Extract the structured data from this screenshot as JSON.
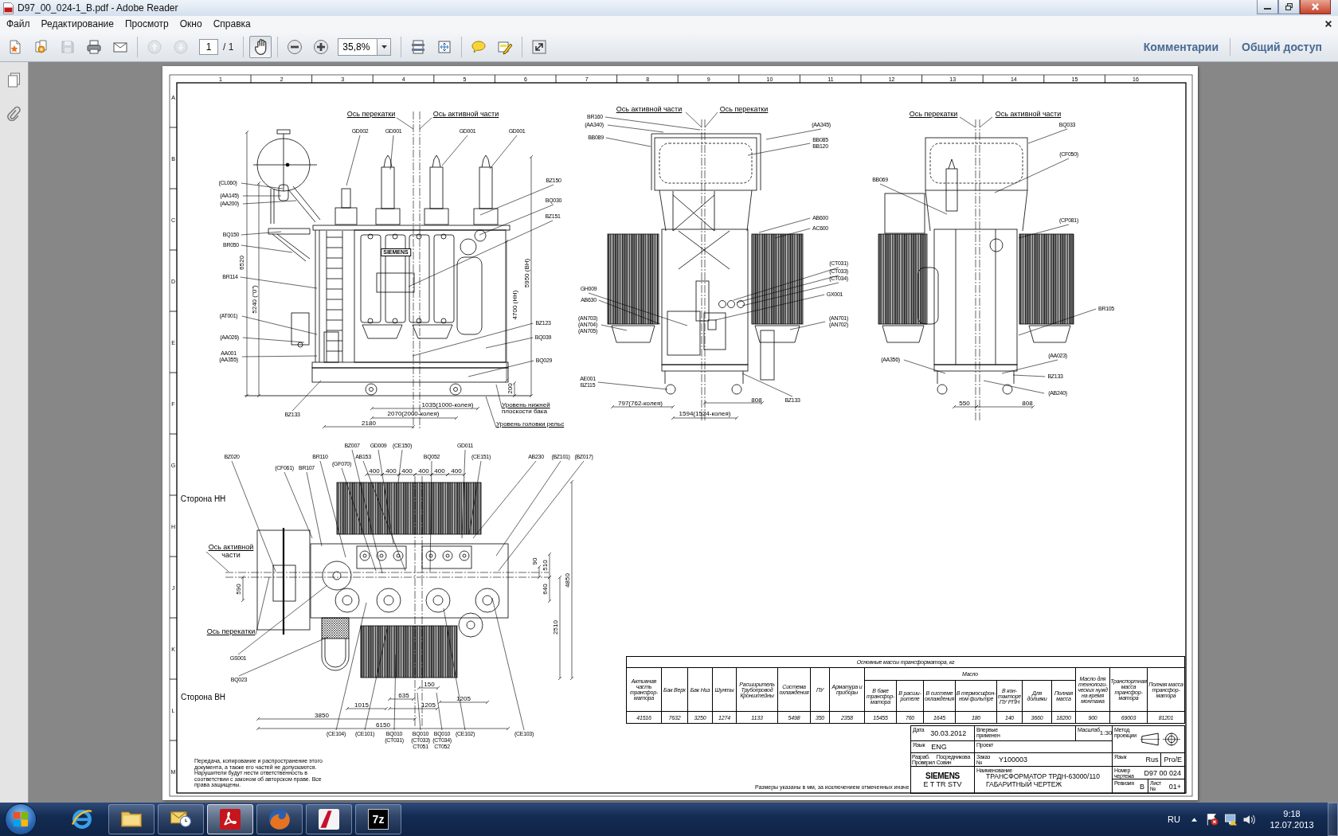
{
  "window": {
    "title": "D97_00_024-1_B.pdf - Adobe Reader"
  },
  "menu": [
    {
      "label": "Файл"
    },
    {
      "label": "Редактирование"
    },
    {
      "label": "Просмотр"
    },
    {
      "label": "Окно"
    },
    {
      "label": "Справка"
    }
  ],
  "toolbar": {
    "groups": [
      [
        {
          "kind": "create",
          "disabled": false
        },
        {
          "kind": "combine",
          "disabled": false
        },
        {
          "kind": "save",
          "disabled": true
        },
        {
          "kind": "print",
          "disabled": false
        },
        {
          "kind": "email",
          "disabled": false
        }
      ],
      [
        {
          "kind": "previous_page",
          "disabled": true
        },
        {
          "kind": "next_page",
          "disabled": true
        },
        {
          "kind": "page_field",
          "value": "1",
          "total": "/ 1"
        }
      ],
      [
        {
          "kind": "hand",
          "selected": true
        }
      ],
      [
        {
          "kind": "zoom_out",
          "disabled": false
        },
        {
          "kind": "zoom_in",
          "disabled": false
        },
        {
          "kind": "zoom_field",
          "value": "35,8%"
        }
      ],
      [
        {
          "kind": "fit_page",
          "disabled": false
        },
        {
          "kind": "fit_width",
          "disabled": false
        }
      ],
      [
        {
          "kind": "comment",
          "disabled": false
        },
        {
          "kind": "highlight",
          "disabled": false
        }
      ],
      [
        {
          "kind": "full_screen",
          "disabled": false
        }
      ]
    ],
    "panel_buttons": [
      {
        "label": "Комментарии"
      },
      {
        "label": "Общий доступ"
      }
    ]
  },
  "sheet": {
    "column_numbers": [
      "1",
      "2",
      "3",
      "4",
      "5",
      "6",
      "7",
      "8",
      "9",
      "10",
      "11",
      "12",
      "13",
      "14",
      "15",
      "16"
    ],
    "row_letters": [
      "A",
      "B",
      "C",
      "D",
      "E",
      "F",
      "G",
      "H",
      "J",
      "K",
      "L",
      "M"
    ],
    "views": [
      {
        "labels": [
          {
            "kind": "axis",
            "text": "Ось перекатки"
          },
          {
            "kind": "axis",
            "text": "Ось активной части"
          },
          {
            "kind": "callout",
            "codes": [
              "GD002"
            ]
          },
          {
            "kind": "callout",
            "codes": [
              "GD001"
            ]
          },
          {
            "kind": "callout",
            "codes": [
              "GD001"
            ]
          },
          {
            "kind": "callout",
            "codes": [
              "GD001"
            ]
          },
          {
            "kind": "callout",
            "codes": [
              "(CL060)"
            ]
          },
          {
            "kind": "callout",
            "codes": [
              "BZ150"
            ]
          },
          {
            "kind": "callout",
            "codes": [
              "(AA145)"
            ]
          },
          {
            "kind": "callout",
            "codes": [
              "(AA200)"
            ]
          },
          {
            "kind": "callout",
            "codes": [
              "BQ030"
            ]
          },
          {
            "kind": "callout",
            "codes": [
              "BZ151"
            ]
          },
          {
            "kind": "callout",
            "codes": [
              "BQ150"
            ]
          },
          {
            "kind": "callout",
            "codes": [
              "BR050"
            ]
          },
          {
            "kind": "plate",
            "text": "SIEMENS"
          },
          {
            "kind": "dimension",
            "text": "6520"
          },
          {
            "kind": "dimension",
            "text": "5950 (ВН)"
          },
          {
            "kind": "callout",
            "codes": [
              "BR114"
            ]
          },
          {
            "kind": "dimension",
            "text": "5240 (\"0\")"
          },
          {
            "kind": "dimension",
            "text": "4700 (НН)"
          },
          {
            "kind": "callout",
            "codes": [
              "(AT001)"
            ]
          },
          {
            "kind": "callout",
            "codes": [
              "BZ123"
            ]
          },
          {
            "kind": "callout",
            "codes": [
              "(AA026)"
            ]
          },
          {
            "kind": "callout",
            "codes": [
              "BQ039"
            ]
          },
          {
            "kind": "callout",
            "codes": [
              "AA001",
              "(AA355)"
            ]
          },
          {
            "kind": "callout",
            "codes": [
              "BQ029"
            ]
          },
          {
            "kind": "dimension",
            "text": "200"
          },
          {
            "kind": "dimension",
            "text": "1035(1000-колея)"
          },
          {
            "kind": "level",
            "text": "Уровень нижней плоскости бака"
          },
          {
            "kind": "callout",
            "codes": [
              "BZ133"
            ]
          },
          {
            "kind": "dimension",
            "text": "2070(2000-колея)"
          },
          {
            "kind": "dimension",
            "text": "2180"
          },
          {
            "kind": "level",
            "text": "Уровень головки рельс"
          }
        ]
      },
      {
        "labels": [
          {
            "kind": "axis",
            "text": "Ось активной части"
          },
          {
            "kind": "axis",
            "text": "Ось перекатки"
          },
          {
            "kind": "callout",
            "codes": [
              "BR160"
            ]
          },
          {
            "kind": "callout",
            "codes": [
              "(AA340)"
            ]
          },
          {
            "kind": "callout",
            "codes": [
              "(AA345)"
            ]
          },
          {
            "kind": "callout",
            "codes": [
              "BB089"
            ]
          },
          {
            "kind": "callout",
            "codes": [
              "BB085",
              "BB120"
            ]
          },
          {
            "kind": "callout",
            "codes": [
              "AB600"
            ]
          },
          {
            "kind": "callout",
            "codes": [
              "AC600"
            ]
          },
          {
            "kind": "callout",
            "codes": [
              "(CT031)"
            ]
          },
          {
            "kind": "callout",
            "codes": [
              "(CT033)"
            ]
          },
          {
            "kind": "callout",
            "codes": [
              "(CT034)"
            ]
          },
          {
            "kind": "callout",
            "codes": [
              "GH009"
            ]
          },
          {
            "kind": "callout",
            "codes": [
              "GX001"
            ]
          },
          {
            "kind": "callout",
            "codes": [
              "AB630"
            ]
          },
          {
            "kind": "callout",
            "codes": [
              "(AN703)",
              "(AN704)",
              "(AN705)"
            ]
          },
          {
            "kind": "callout",
            "codes": [
              "(AN701)",
              "(AN702)"
            ]
          },
          {
            "kind": "callout",
            "codes": [
              "AE001",
              "BZ115"
            ]
          },
          {
            "kind": "dimension",
            "text": "797(762-колея)"
          },
          {
            "kind": "dimension",
            "text": "808"
          },
          {
            "kind": "callout",
            "codes": [
              "BZ133"
            ]
          },
          {
            "kind": "dimension",
            "text": "1594(1524-колея)"
          }
        ]
      },
      {
        "labels": [
          {
            "kind": "axis",
            "text": "Ось перекатки"
          },
          {
            "kind": "axis",
            "text": "Ось активной части"
          },
          {
            "kind": "callout",
            "codes": [
              "BQ033"
            ]
          },
          {
            "kind": "callout",
            "codes": [
              "(CF050)"
            ]
          },
          {
            "kind": "callout",
            "codes": [
              "BB069"
            ]
          },
          {
            "kind": "callout",
            "codes": [
              "(CP081)"
            ]
          },
          {
            "kind": "callout",
            "codes": [
              "BR105"
            ]
          },
          {
            "kind": "callout",
            "codes": [
              "(AA356)"
            ]
          },
          {
            "kind": "callout",
            "codes": [
              "(AA023)"
            ]
          },
          {
            "kind": "callout",
            "codes": [
              "BZ133"
            ]
          },
          {
            "kind": "callout",
            "codes": [
              "(AB240)"
            ]
          },
          {
            "kind": "dimension",
            "text": "550"
          },
          {
            "kind": "dimension",
            "text": "808"
          }
        ]
      },
      {
        "labels": [
          {
            "kind": "callout",
            "codes": [
              "BZ007"
            ]
          },
          {
            "kind": "callout",
            "codes": [
              "GD009"
            ]
          },
          {
            "kind": "callout",
            "codes": [
              "(CE150)"
            ]
          },
          {
            "kind": "callout",
            "codes": [
              "GD011"
            ]
          },
          {
            "kind": "callout",
            "codes": [
              "BZ020"
            ]
          },
          {
            "kind": "callout",
            "codes": [
              "BR110"
            ]
          },
          {
            "kind": "callout",
            "codes": [
              "AB153"
            ]
          },
          {
            "kind": "callout",
            "codes": [
              "BQ052"
            ]
          },
          {
            "kind": "callout",
            "codes": [
              "(CE151)"
            ]
          },
          {
            "kind": "callout",
            "codes": [
              "AB230"
            ]
          },
          {
            "kind": "callout",
            "codes": [
              "(BZ101)"
            ]
          },
          {
            "kind": "callout",
            "codes": [
              "(BZ017)"
            ]
          },
          {
            "kind": "callout",
            "codes": [
              "(CF061)"
            ]
          },
          {
            "kind": "callout",
            "codes": [
              "BR107"
            ]
          },
          {
            "kind": "callout",
            "codes": [
              "(GF070)"
            ]
          },
          {
            "kind": "dimension",
            "text": "400"
          },
          {
            "kind": "dimension",
            "text": "400"
          },
          {
            "kind": "dimension",
            "text": "400"
          },
          {
            "kind": "dimension",
            "text": "400"
          },
          {
            "kind": "dimension",
            "text": "400"
          },
          {
            "kind": "dimension",
            "text": "400"
          },
          {
            "kind": "note",
            "text": "Сторона НН"
          },
          {
            "kind": "axis",
            "text": "Ось активной части"
          },
          {
            "kind": "dimension",
            "text": "90"
          },
          {
            "kind": "dimension",
            "text": "510"
          },
          {
            "kind": "dimension",
            "text": "4850"
          },
          {
            "kind": "dimension",
            "text": "590"
          },
          {
            "kind": "dimension",
            "text": "640"
          },
          {
            "kind": "axis",
            "text": "Ось перекатки"
          },
          {
            "kind": "dimension",
            "text": "2510"
          },
          {
            "kind": "callout",
            "codes": [
              "GS001"
            ]
          },
          {
            "kind": "callout",
            "codes": [
              "BQ023"
            ]
          },
          {
            "kind": "dimension",
            "text": "150"
          },
          {
            "kind": "note",
            "text": "Сторона ВН"
          },
          {
            "kind": "dimension",
            "text": "635"
          },
          {
            "kind": "dimension",
            "text": "1205"
          },
          {
            "kind": "dimension",
            "text": "1015"
          },
          {
            "kind": "dimension",
            "text": "1205"
          },
          {
            "kind": "dimension",
            "text": "3850"
          },
          {
            "kind": "dimension",
            "text": "6150"
          },
          {
            "kind": "callout",
            "codes": [
              "(CE104)"
            ]
          },
          {
            "kind": "callout",
            "codes": [
              "(CE101)"
            ]
          },
          {
            "kind": "callout",
            "codes": [
              "BQ010",
              "(CT031)"
            ]
          },
          {
            "kind": "callout",
            "codes": [
              "BQ010",
              "(CT033)",
              "CT051"
            ]
          },
          {
            "kind": "callout",
            "codes": [
              "BQ010",
              "(CT034)",
              "CT052"
            ]
          },
          {
            "kind": "callout",
            "codes": [
              "(CE102)"
            ]
          },
          {
            "kind": "callout",
            "codes": [
              "(CE103)"
            ]
          }
        ]
      }
    ],
    "mass_table": {
      "title": "Основные массы трансформатора, кг",
      "columns": [
        {
          "header": "Активная часть трансфор-матора"
        },
        {
          "header": "Бак Верх"
        },
        {
          "header": "Бак Низ"
        },
        {
          "header": "Шунты"
        },
        {
          "header": "Расширитель Трубопровод Кронштейны"
        },
        {
          "header": "Система охлаждения"
        },
        {
          "header": "ПУ"
        },
        {
          "header": "Арматура и приборы"
        },
        {
          "group": "Масло",
          "columns": [
            {
              "header": "В баке трансфор-матора"
            },
            {
              "header": "В расши-рителе"
            },
            {
              "header": "В системе охлаждения"
            },
            {
              "header": "В термосифон-ном фильтре"
            },
            {
              "header": "В кон-такторе ПУ РПН"
            },
            {
              "header": "Для доливки"
            },
            {
              "header": "Полная масса"
            }
          ]
        },
        {
          "header": "Масло для технологи-ческих нужд на время монтажа"
        },
        {
          "header": "Транспортная масса трансфор-матора"
        },
        {
          "header": "Полная масса трансфор-матора"
        }
      ],
      "values": [
        "41516",
        "7632",
        "3250",
        "1274",
        "1133",
        "5498",
        "350",
        "2358",
        "15455",
        "760",
        "1645",
        "180",
        "140",
        "3660",
        "18200",
        "900",
        "69003",
        "81201"
      ]
    },
    "copyright_note": "Передача, копирование и распространение этого документа, а также его частей не допускаются. Нарушители будут нести ответственность в соответствии с законом об авторском праве. Все права защищены.",
    "dimensions_note": "Размеры указаны в мм, за исключением отмеченных иначе",
    "title_block": {
      "date": {
        "label": "Дата",
        "value": "30.03.2012"
      },
      "first_use": {
        "label": "Впервые применен"
      },
      "scale": {
        "label": "Масштаб",
        "value": "1:30"
      },
      "projection": {
        "label": "Метод проекции"
      },
      "language": {
        "label": "Язык",
        "value": "ENG"
      },
      "project": {
        "label": "Проект"
      },
      "staff": [
        {
          "label": "Разраб.",
          "name": "Посредникова"
        },
        {
          "label": "Проверил",
          "name": "Совин"
        }
      ],
      "order": {
        "label": "Заказ №",
        "value": "Y100003"
      },
      "format": {
        "label": "Язык",
        "values": [
          "Rus",
          "Pro/E"
        ]
      },
      "company": "SIEMENS",
      "department": "E T TR STV",
      "name": {
        "label": "Наименование",
        "lines": [
          "ТРАНСФОРМАТОР ТРДН-63000/110",
          "ГАБАРИТНЫЙ ЧЕРТЕЖ"
        ]
      },
      "drawing_number": {
        "label": "Номер чертежа",
        "value": "D97 00 024"
      },
      "revision": {
        "label": "Ревизия",
        "value": "B"
      },
      "sheet": {
        "label": "Лист №",
        "value": "01+"
      }
    }
  },
  "taskbar": {
    "apps": [
      {
        "kind": "browser",
        "running": false,
        "selected": false
      },
      {
        "kind": "explorer",
        "running": true,
        "selected": false
      },
      {
        "kind": "mail",
        "running": true,
        "selected": false
      },
      {
        "kind": "pdf",
        "running": true,
        "selected": true
      },
      {
        "kind": "firefox",
        "running": true,
        "selected": false
      },
      {
        "kind": "cad",
        "running": true,
        "selected": false
      },
      {
        "kind": "archiver",
        "running": true,
        "selected": false,
        "glyph": "7z"
      }
    ],
    "language": "RU",
    "time": "9:18",
    "date": "12.07.2013"
  }
}
